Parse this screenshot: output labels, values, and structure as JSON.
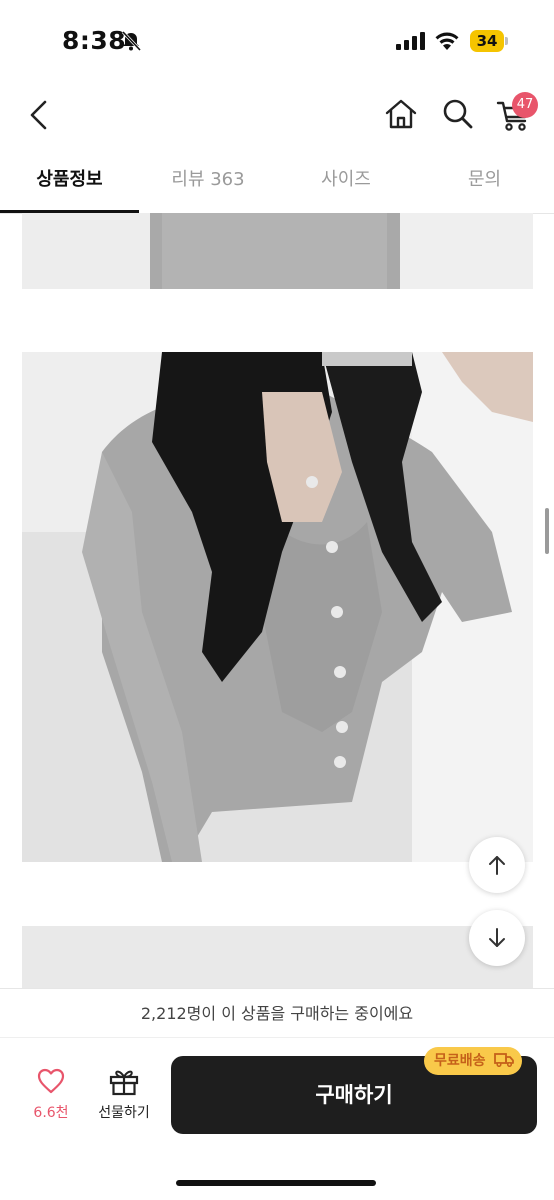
{
  "status_bar": {
    "time": "8:38",
    "battery": "34"
  },
  "header": {
    "cart_count": "47",
    "icons": [
      "back-icon",
      "home-icon",
      "search-icon",
      "cart-icon"
    ]
  },
  "tabs": [
    {
      "label": "상품정보",
      "active": true
    },
    {
      "label": "리뷰 363",
      "active": false
    },
    {
      "label": "사이즈",
      "active": false
    },
    {
      "label": "문의",
      "active": false
    }
  ],
  "footer": {
    "purchase_notice": "2,212명이 이 상품을 구매하는 중이에요",
    "like_count": "6.6천",
    "gift_label": "선물하기",
    "buy_label": "구매하기",
    "shipping_badge": "무료배송"
  },
  "colors": {
    "accent": "#e8556b",
    "buy_button": "#1e1e1e",
    "badge_bg": "#f9c94a",
    "badge_text": "#c5611a"
  }
}
